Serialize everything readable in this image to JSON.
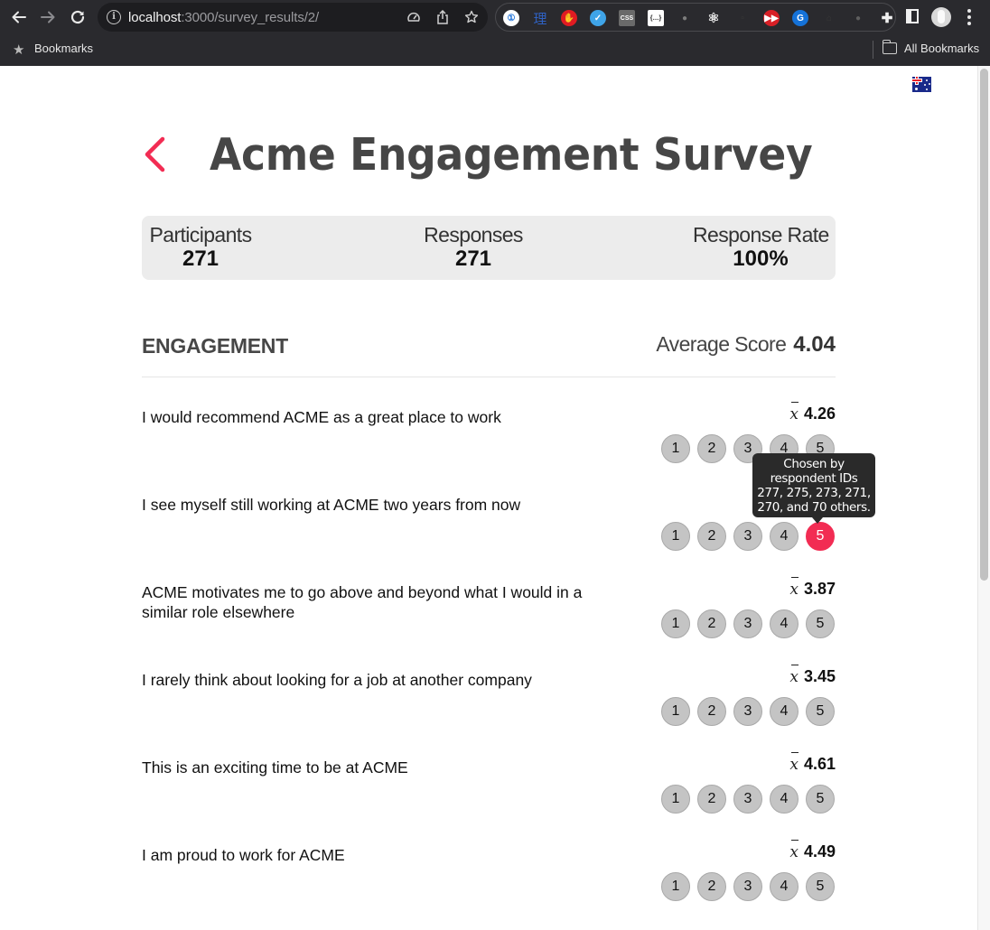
{
  "browser": {
    "url_host": "localhost",
    "url_path": ":3000/survey_results/2/",
    "bookmarks_label": "Bookmarks",
    "all_bookmarks_label": "All Bookmarks",
    "extensions": [
      {
        "name": "1password-extension-icon",
        "glyph": "①",
        "bg": "#ffffff",
        "fg": "#1a6fd8"
      },
      {
        "name": "chinese-reader-extension-icon",
        "glyph": "理",
        "bg": "transparent",
        "fg": "#2f62c4"
      },
      {
        "name": "adblock-extension-icon",
        "glyph": "✋",
        "bg": "#e01b22",
        "fg": "#ffffff"
      },
      {
        "name": "vimeo-extension-icon",
        "glyph": "✓",
        "bg": "#3fa4e8",
        "fg": "#ffffff"
      },
      {
        "name": "css-viewer-extension-icon",
        "glyph": "CSS",
        "bg": "#6a6a6a",
        "fg": "#ffffff"
      },
      {
        "name": "json-viewer-extension-icon",
        "glyph": "{…}",
        "bg": "#ffffff",
        "fg": "#222222"
      },
      {
        "name": "android-extension-icon",
        "glyph": "●",
        "bg": "transparent",
        "fg": "#7c7c7c"
      },
      {
        "name": "react-devtools-extension-icon",
        "glyph": "⚛",
        "bg": "transparent",
        "fg": "#e8e8e8"
      },
      {
        "name": "hidden-extension-icon",
        "glyph": "▫",
        "bg": "transparent",
        "fg": "#3a3a3a"
      },
      {
        "name": "youtube-speed-extension-icon",
        "glyph": "▶▶",
        "bg": "#d81f26",
        "fg": "#ffffff"
      },
      {
        "name": "grammar-extension-icon",
        "glyph": "G",
        "bg": "#1572d8",
        "fg": "#ffffff"
      },
      {
        "name": "home-extension-icon",
        "glyph": "⌂",
        "bg": "transparent",
        "fg": "#3a3a3a"
      },
      {
        "name": "bug-extension-icon",
        "glyph": "●",
        "bg": "transparent",
        "fg": "#5e5e5e"
      },
      {
        "name": "puzzle-extensions-icon",
        "glyph": "✚",
        "bg": "transparent",
        "fg": "#f0f0f0"
      }
    ]
  },
  "page": {
    "title": "Acme Engagement Survey",
    "accent_color": "#f22c53",
    "stats": [
      {
        "label": "Participants",
        "value": "271"
      },
      {
        "label": "Responses",
        "value": "271"
      },
      {
        "label": "Response Rate",
        "value": "100%"
      }
    ],
    "section": {
      "title": "ENGAGEMENT",
      "average_label": "Average Score",
      "average_value": "4.04"
    },
    "options": [
      "1",
      "2",
      "3",
      "4",
      "5"
    ],
    "questions": [
      {
        "text": "I would recommend ACME as a great place to work",
        "mean": "4.26",
        "selected": null
      },
      {
        "text": "I see myself still working at ACME two years from now",
        "mean": null,
        "selected": "5"
      },
      {
        "text": "ACME motivates me to go above and beyond what I would in a similar role elsewhere",
        "mean": "3.87",
        "selected": null
      },
      {
        "text": "I rarely think about looking for a job at another company",
        "mean": "3.45",
        "selected": null
      },
      {
        "text": "This is an exciting time to be at ACME",
        "mean": "4.61",
        "selected": null
      },
      {
        "text": "I am proud to work for ACME",
        "mean": "4.49",
        "selected": null
      }
    ],
    "tooltip": {
      "lines": [
        "Chosen by",
        "respondent IDs",
        "277, 275, 273, 271,",
        "270, and 70 others."
      ]
    }
  }
}
